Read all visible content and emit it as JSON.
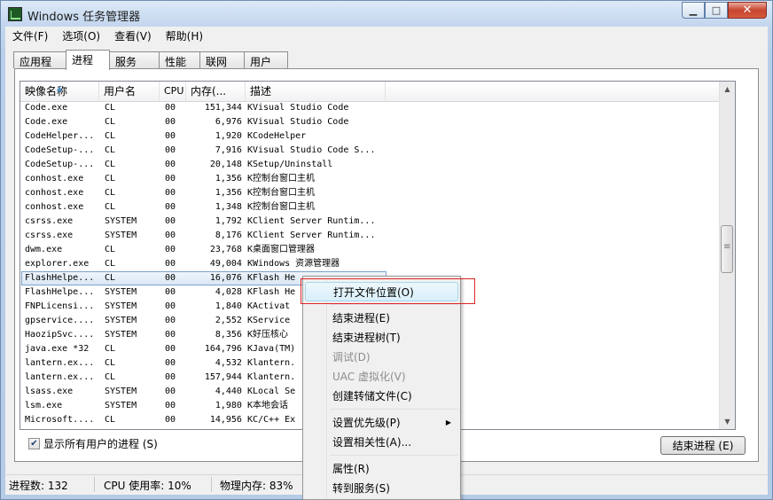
{
  "window": {
    "title": "Windows 任务管理器"
  },
  "menu": [
    "文件(F)",
    "选项(O)",
    "查看(V)",
    "帮助(H)"
  ],
  "tabs": [
    "应用程序",
    "进程",
    "服务",
    "性能",
    "联网",
    "用户"
  ],
  "active_tab": "进程",
  "columns": [
    "映像名称",
    "用户名",
    "CPU",
    "内存(...",
    "描述"
  ],
  "rows": [
    {
      "name": "Code.exe",
      "user": "CL",
      "cpu": "00",
      "mem": "151,344 K",
      "desc": "Visual Studio Code"
    },
    {
      "name": "Code.exe",
      "user": "CL",
      "cpu": "00",
      "mem": "6,976 K",
      "desc": "Visual Studio Code"
    },
    {
      "name": "CodeHelper...",
      "user": "CL",
      "cpu": "00",
      "mem": "1,920 K",
      "desc": "CodeHelper"
    },
    {
      "name": "CodeSetup-...",
      "user": "CL",
      "cpu": "00",
      "mem": "7,916 K",
      "desc": "Visual Studio Code S..."
    },
    {
      "name": "CodeSetup-...",
      "user": "CL",
      "cpu": "00",
      "mem": "20,148 K",
      "desc": "Setup/Uninstall"
    },
    {
      "name": "conhost.exe",
      "user": "CL",
      "cpu": "00",
      "mem": "1,356 K",
      "desc": "控制台窗口主机"
    },
    {
      "name": "conhost.exe",
      "user": "CL",
      "cpu": "00",
      "mem": "1,356 K",
      "desc": "控制台窗口主机"
    },
    {
      "name": "conhost.exe",
      "user": "CL",
      "cpu": "00",
      "mem": "1,348 K",
      "desc": "控制台窗口主机"
    },
    {
      "name": "csrss.exe",
      "user": "SYSTEM",
      "cpu": "00",
      "mem": "1,792 K",
      "desc": "Client Server Runtim..."
    },
    {
      "name": "csrss.exe",
      "user": "SYSTEM",
      "cpu": "00",
      "mem": "8,176 K",
      "desc": "Client Server Runtim..."
    },
    {
      "name": "dwm.exe",
      "user": "CL",
      "cpu": "00",
      "mem": "23,768 K",
      "desc": "桌面窗口管理器"
    },
    {
      "name": "explorer.exe",
      "user": "CL",
      "cpu": "00",
      "mem": "49,004 K",
      "desc": "Windows 资源管理器"
    },
    {
      "name": "FlashHelpe...",
      "user": "CL",
      "cpu": "00",
      "mem": "16,076 K",
      "desc": "Flash He"
    },
    {
      "name": "FlashHelpe...",
      "user": "SYSTEM",
      "cpu": "00",
      "mem": "4,028 K",
      "desc": "Flash He"
    },
    {
      "name": "FNPLicensi...",
      "user": "SYSTEM",
      "cpu": "00",
      "mem": "1,840 K",
      "desc": "Activat"
    },
    {
      "name": "gpservice....",
      "user": "SYSTEM",
      "cpu": "00",
      "mem": "2,552 K",
      "desc": "Service"
    },
    {
      "name": "HaozipSvc....",
      "user": "SYSTEM",
      "cpu": "00",
      "mem": "8,356 K",
      "desc": "好压核心"
    },
    {
      "name": "java.exe *32",
      "user": "CL",
      "cpu": "00",
      "mem": "164,796 K",
      "desc": "Java(TM)"
    },
    {
      "name": "lantern.ex...",
      "user": "CL",
      "cpu": "00",
      "mem": "4,532 K",
      "desc": "lantern."
    },
    {
      "name": "lantern.ex...",
      "user": "CL",
      "cpu": "00",
      "mem": "157,944 K",
      "desc": "lantern."
    },
    {
      "name": "lsass.exe",
      "user": "SYSTEM",
      "cpu": "00",
      "mem": "4,440 K",
      "desc": "Local Se"
    },
    {
      "name": "lsm.exe",
      "user": "SYSTEM",
      "cpu": "00",
      "mem": "1,980 K",
      "desc": "本地会话"
    },
    {
      "name": "Microsoft....",
      "user": "CL",
      "cpu": "00",
      "mem": "14,956 K",
      "desc": "C/C++ Ex"
    }
  ],
  "selected_row_index": 12,
  "show_all_users": {
    "label": "显示所有用户的进程 (S)",
    "checked": true
  },
  "end_process_button": "结束进程 (E)",
  "status": {
    "processes": "进程数: 132",
    "cpu": "CPU 使用率: 10%",
    "memory": "物理内存: 83%"
  },
  "context_menu": {
    "open_location": "打开文件位置(O)",
    "end_process": "结束进程(E)",
    "end_tree": "结束进程树(T)",
    "debug": "调试(D)",
    "uac": "UAC 虚拟化(V)",
    "dump": "创建转储文件(C)",
    "priority": "设置优先级(P)",
    "affinity": "设置相关性(A)...",
    "properties": "属性(R)",
    "goto_service": "转到服务(S)"
  }
}
